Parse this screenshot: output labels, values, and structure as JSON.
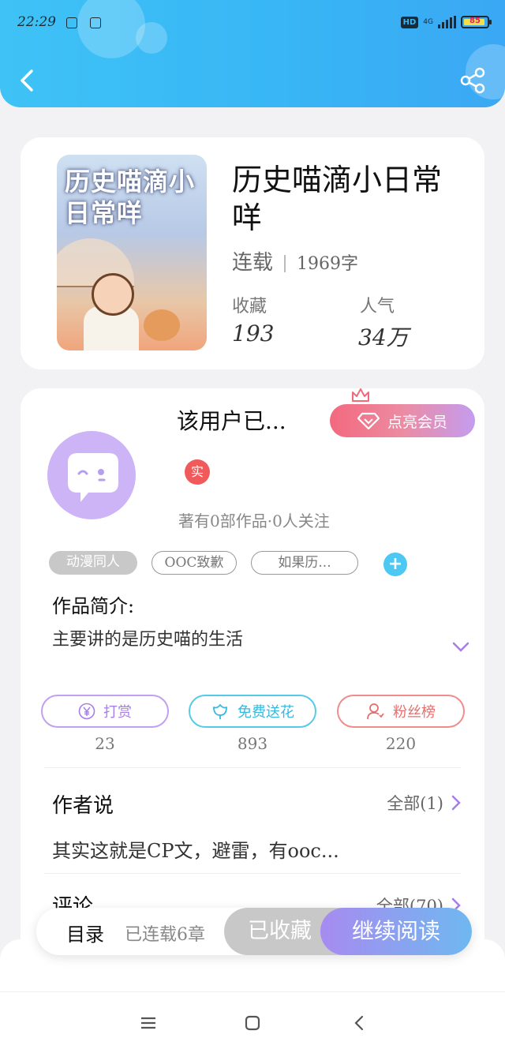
{
  "status_bar": {
    "time": "22:29",
    "network": "HD",
    "signal": "4G",
    "battery": "85"
  },
  "book": {
    "cover_title": "历史喵滴小日常咩",
    "title": "历史喵滴小日常咩",
    "status": "连载",
    "word_count": "1969字",
    "favorites_label": "收藏",
    "favorites_value": "193",
    "popularity_label": "人气",
    "popularity_value": "34万"
  },
  "author": {
    "name": "该用户已...",
    "vip_button": "点亮会员",
    "real_badge": "实",
    "follow_info": "著有0部作品·0人关注"
  },
  "tags": [
    "动漫同人",
    "OOC致歉",
    "如果历..."
  ],
  "intro": {
    "label": "作品简介:",
    "text": "主要讲的是历史喵的生活"
  },
  "actions": [
    {
      "label": "打赏",
      "count": "23"
    },
    {
      "label": "免费送花",
      "count": "893"
    },
    {
      "label": "粉丝榜",
      "count": "220"
    }
  ],
  "author_says": {
    "title": "作者说",
    "more": "全部(1)",
    "text": "其实这就是CP文，避雷，有ooc..."
  },
  "comments": {
    "title": "评论",
    "more": "全部(70)"
  },
  "bottom_bar": {
    "toc": "目录",
    "chapters": "已连载6章",
    "collected": "已收藏",
    "continue": "继续阅读"
  },
  "colors": {
    "header": "#38b6f5",
    "accent_purple": "#a77ee8",
    "accent_red": "#f05a5a"
  }
}
